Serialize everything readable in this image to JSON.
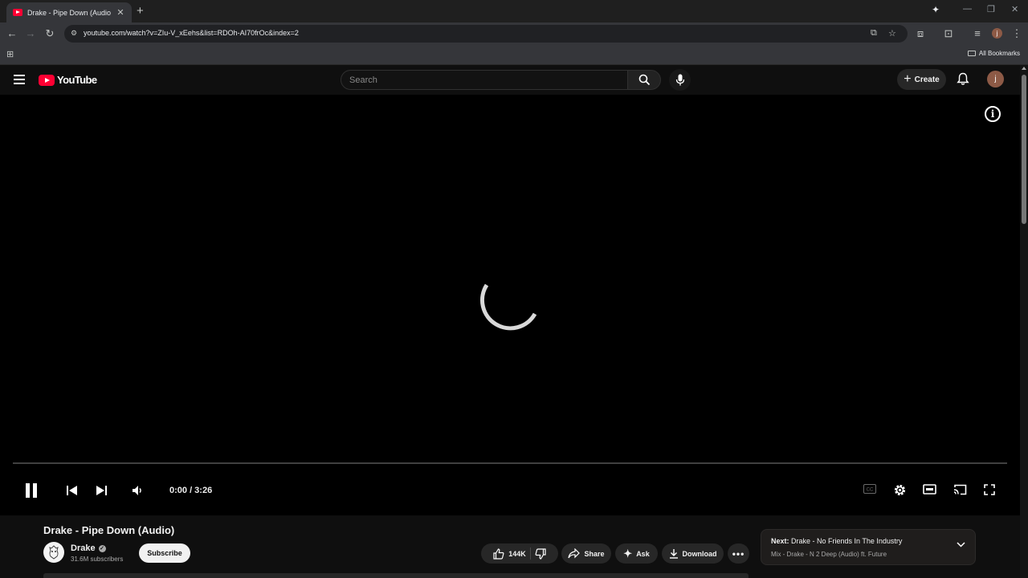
{
  "browser": {
    "tab_title": "Drake - Pipe Down (Audio) - Yo",
    "tab_close": "✕",
    "new_tab": "+",
    "url": "youtube.com/watch?v=ZIu-V_xEehs&list=RDOh-AI70frOc&index=2",
    "bookmarks_label": "All Bookmarks",
    "window_controls": [
      "—",
      "❐",
      "✕"
    ]
  },
  "masthead": {
    "logo_text": "YouTube",
    "search_placeholder": "Search",
    "create_label": "Create",
    "avatar_letter": "j"
  },
  "player": {
    "state": "loading",
    "time": "0:00 / 3:26",
    "progress": 0.0
  },
  "video": {
    "title": "Drake - Pipe Down (Audio)",
    "channel": "Drake",
    "subscribers": "31.6M subscribers",
    "subscribe_label": "Subscribe",
    "likes": "144K",
    "share_label": "Share",
    "ask_label": "Ask",
    "download_label": "Download"
  },
  "up_next": {
    "label": "Next:",
    "title": "Drake - No Friends In The Industry",
    "subtitle": "Mix - Drake - N 2 Deep (Audio) ft. Future"
  },
  "colors": {
    "brand_red": "#ff0033",
    "background": "#0f0f0f",
    "chrome": "#35363a"
  }
}
